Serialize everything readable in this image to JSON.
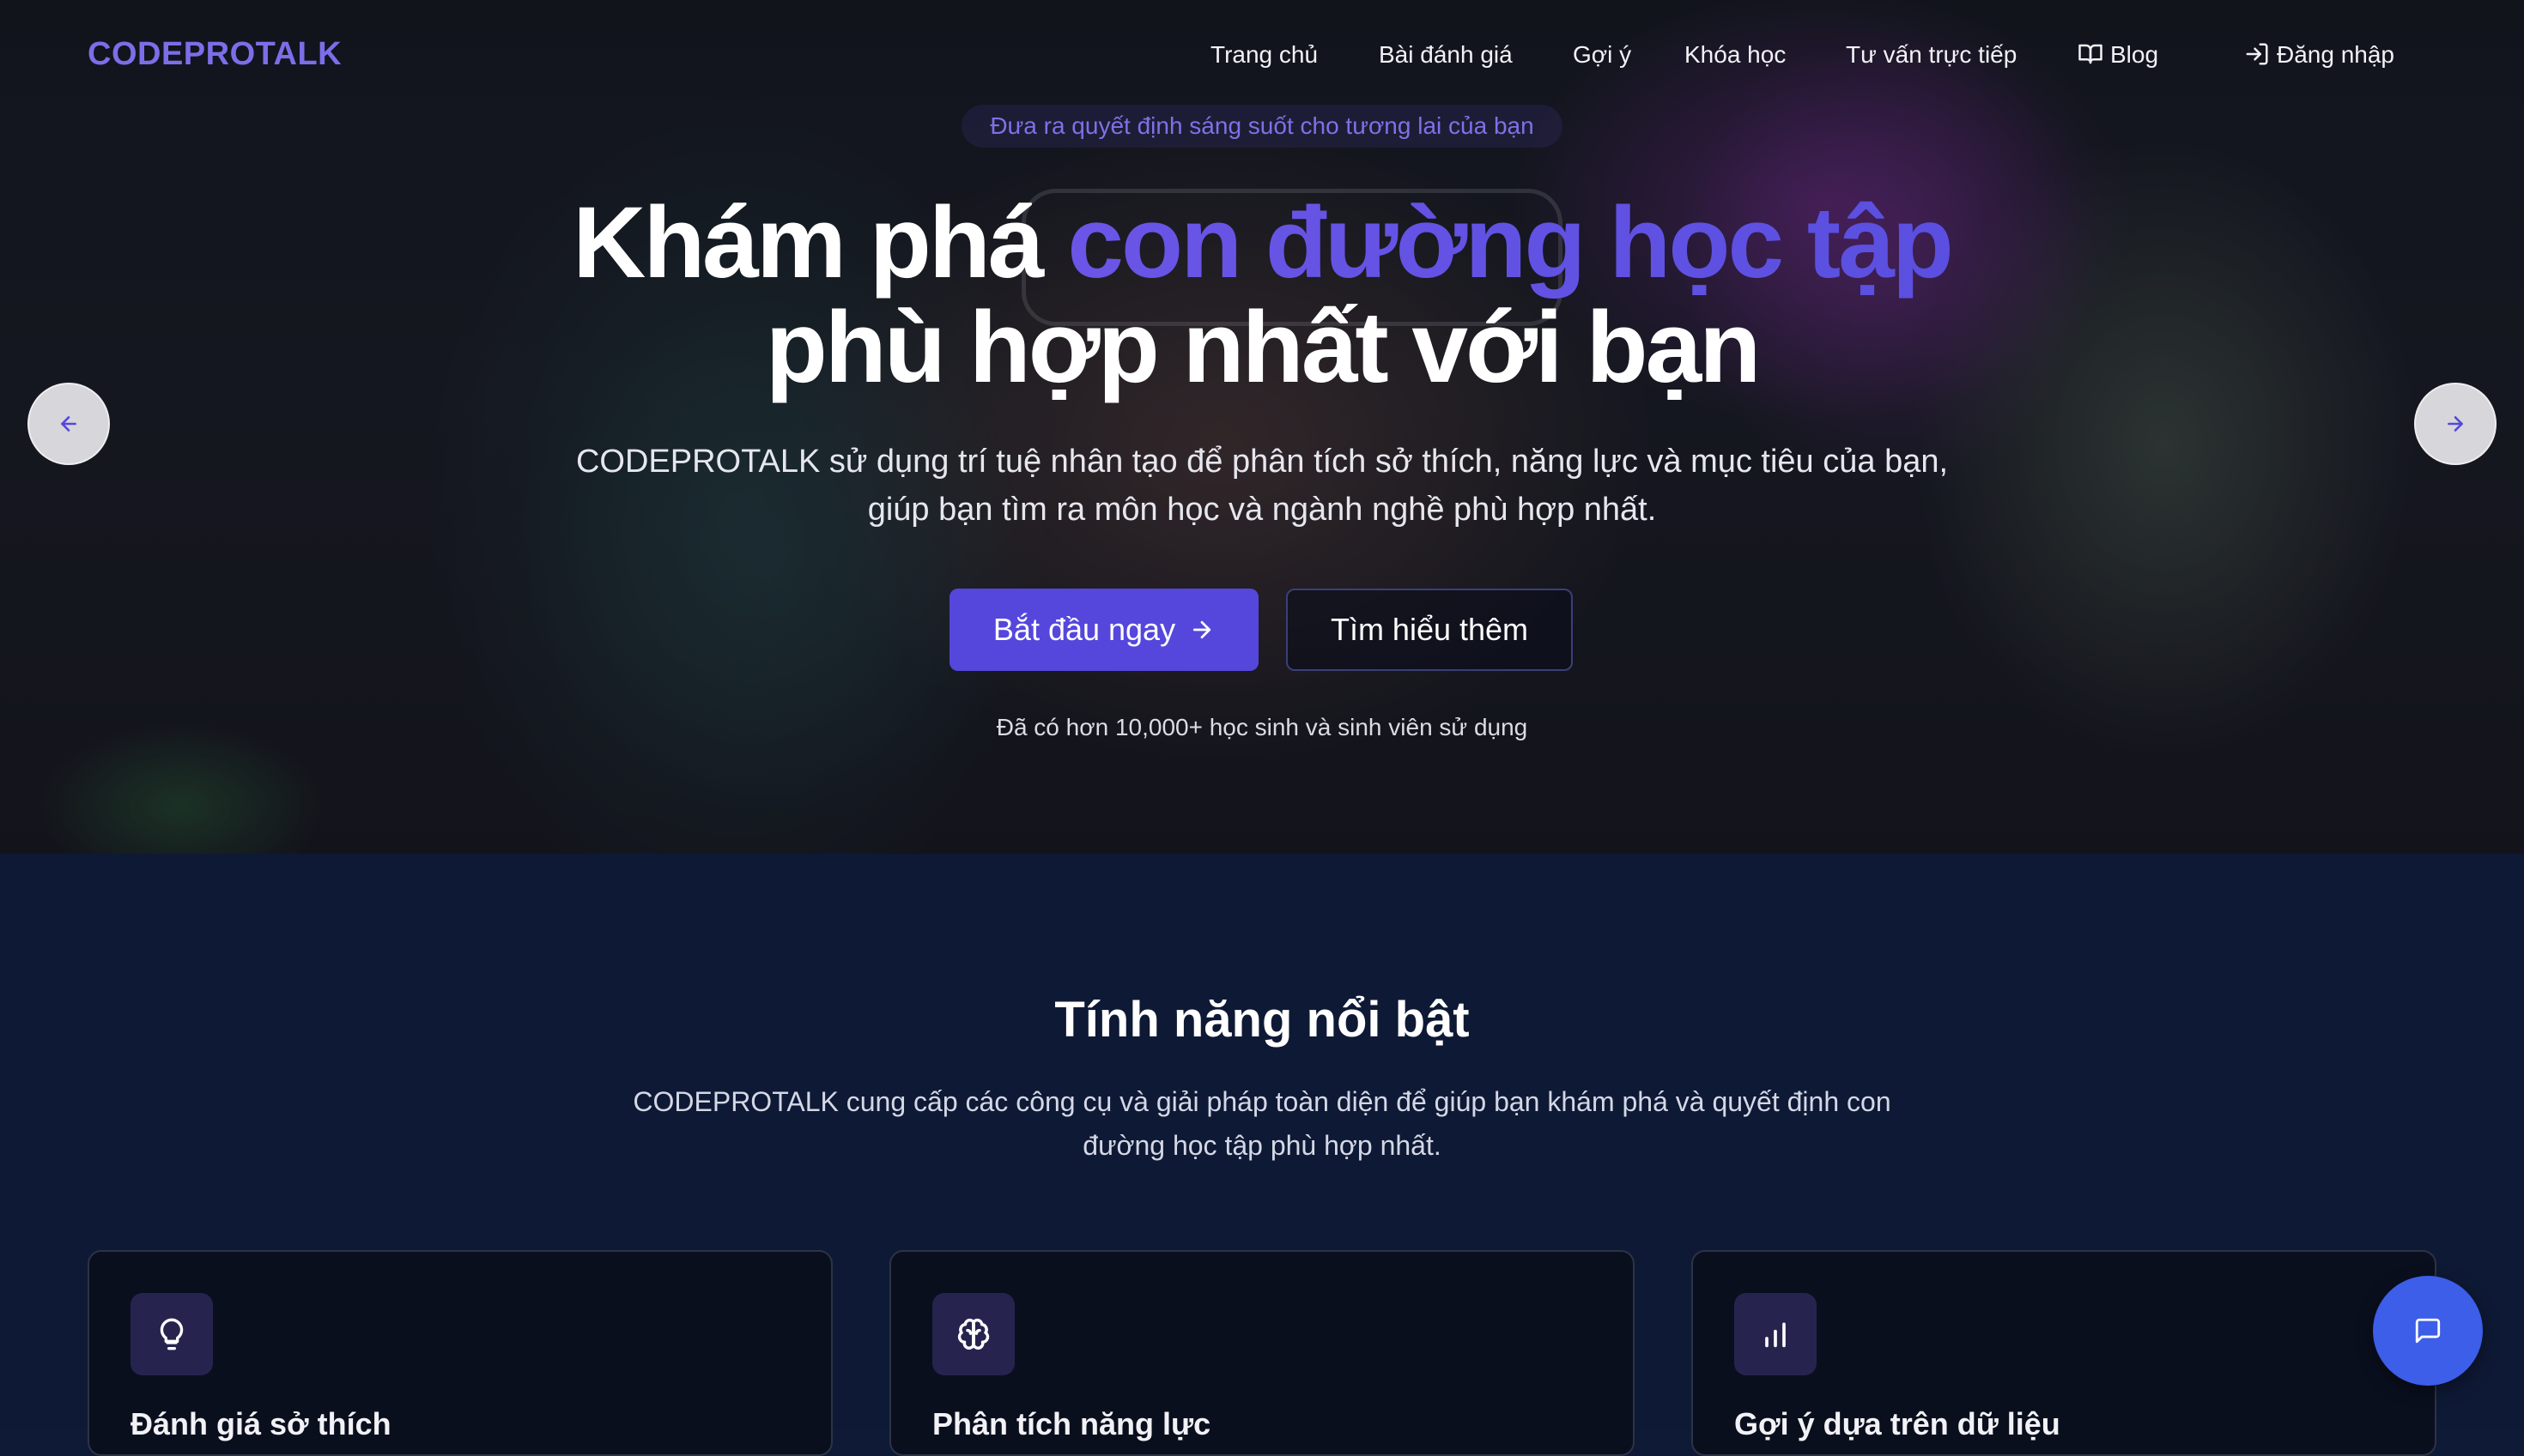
{
  "brand": {
    "logo": "CODEPROTALK"
  },
  "nav": {
    "items": [
      {
        "label": "Trang chủ"
      },
      {
        "label": "Bài đánh giá"
      },
      {
        "label": "Gợi ý"
      },
      {
        "label": "Khóa học"
      },
      {
        "label": "Tư vấn trực tiếp"
      },
      {
        "label": "Blog",
        "icon": "book-icon"
      }
    ],
    "login": {
      "label": "Đăng nhập",
      "icon": "login-icon"
    }
  },
  "hero": {
    "tagline": "Đưa ra quyết định sáng suốt cho tương lai của bạn",
    "title_plain": "Khám phá",
    "title_accent": "con đường học tập",
    "title_line2": "phù hợp nhất với bạn",
    "description": "CODEPROTALK sử dụng trí tuệ nhân tạo để phân tích sở thích, năng lực và mục tiêu của bạn, giúp bạn tìm ra môn học và ngành nghề phù hợp nhất.",
    "primary_button": "Bắt đầu ngay",
    "secondary_button": "Tìm hiểu thêm",
    "note": "Đã có hơn 10,000+ học sinh và sinh viên sử dụng",
    "carousel": {
      "prev_icon": "arrow-left-icon",
      "next_icon": "arrow-right-icon"
    }
  },
  "features": {
    "title": "Tính năng nổi bật",
    "description": "CODEPROTALK cung cấp các công cụ và giải pháp toàn diện để giúp bạn khám phá và quyết định con đường học tập phù hợp nhất.",
    "cards": [
      {
        "icon": "lightbulb-icon",
        "title": "Đánh giá sở thích"
      },
      {
        "icon": "brain-icon",
        "title": "Phân tích năng lực"
      },
      {
        "icon": "bar-chart-icon",
        "title": "Gợi ý dựa trên dữ liệu"
      }
    ]
  },
  "chat": {
    "icon": "chat-icon"
  },
  "colors": {
    "accent": "#5547dc",
    "logo": "#7b6ee8",
    "features_bg": "#0e1935",
    "card_bg": "#0a0f1e",
    "chat_button": "#3c5ee8"
  }
}
